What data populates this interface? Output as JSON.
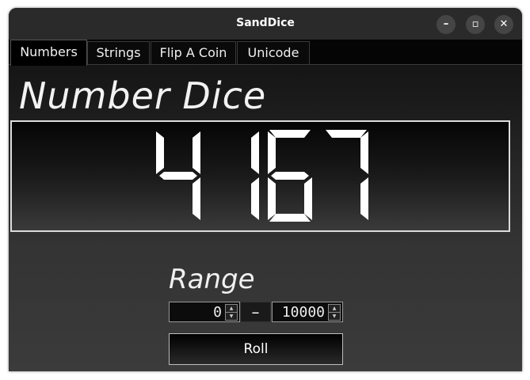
{
  "window": {
    "title": "SandDice"
  },
  "window_controls": {
    "minimize": "–",
    "maximize": "▫",
    "close": "✕"
  },
  "tabs": [
    {
      "label": "Numbers",
      "active": true
    },
    {
      "label": "Strings",
      "active": false
    },
    {
      "label": "Flip A Coin",
      "active": false
    },
    {
      "label": "Unicode",
      "active": false
    }
  ],
  "main": {
    "heading": "Number Dice",
    "result": "4167",
    "range": {
      "label": "Range",
      "min": "0",
      "separator": "–",
      "max": "10000"
    },
    "roll_label": "Roll"
  },
  "colors": {
    "background": "#1c1c1c",
    "digit": "#ffffff",
    "border": "#dcdcdc"
  }
}
